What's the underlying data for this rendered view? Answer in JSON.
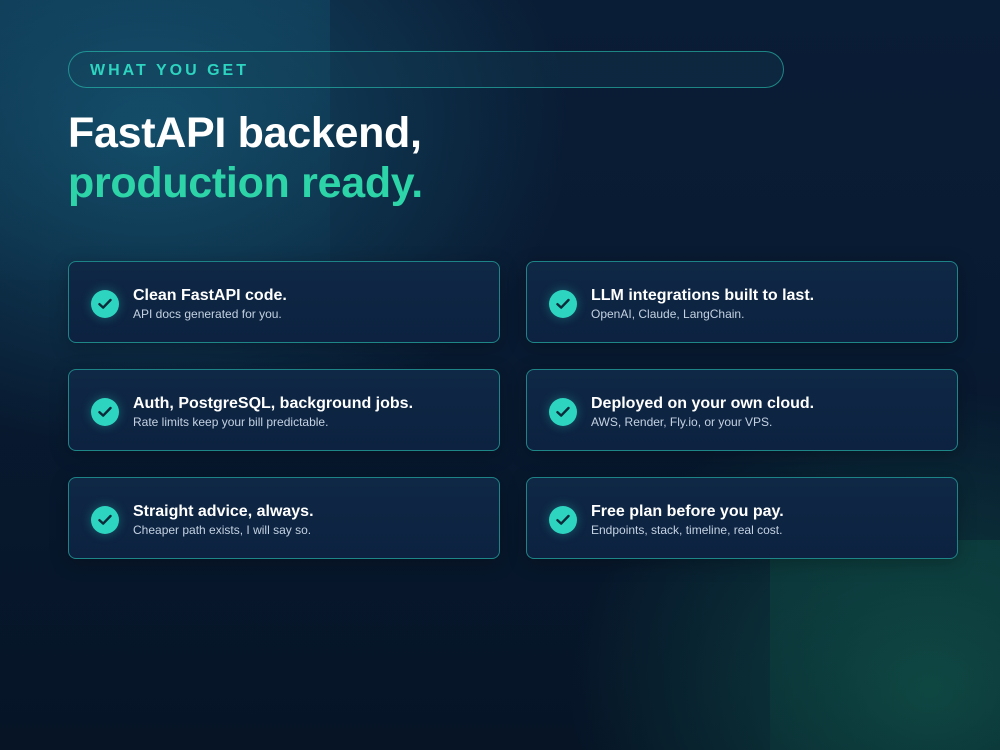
{
  "eyebrow": "WHAT YOU GET",
  "headline": {
    "line1": "FastAPI backend,",
    "line2": "production ready."
  },
  "features": [
    {
      "title": "Clean FastAPI code.",
      "subtitle": "API docs generated for you.",
      "icon": "check-circle-icon"
    },
    {
      "title": "LLM integrations built to last.",
      "subtitle": "OpenAI, Claude, LangChain.",
      "icon": "check-circle-icon"
    },
    {
      "title": "Auth, PostgreSQL, background jobs.",
      "subtitle": "Rate limits keep your bill predictable.",
      "icon": "check-circle-icon"
    },
    {
      "title": "Deployed on your own cloud.",
      "subtitle": "AWS, Render, Fly.io, or your VPS.",
      "icon": "check-circle-icon"
    },
    {
      "title": "Straight advice, always.",
      "subtitle": "Cheaper path exists, I will say so.",
      "icon": "check-circle-icon"
    },
    {
      "title": "Free plan before you pay.",
      "subtitle": "Endpoints, stack, timeline, real cost.",
      "icon": "check-circle-icon"
    }
  ],
  "colors": {
    "accent": "#2dd4bf",
    "headline_accent": "#2dd4a7",
    "background": "#071529",
    "card_background": "#0f2845"
  }
}
